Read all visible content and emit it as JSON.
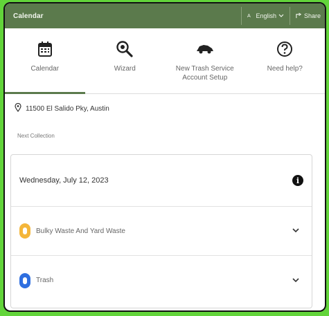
{
  "topbar": {
    "title": "Calendar",
    "language": "English",
    "share": "Share"
  },
  "tabs": [
    {
      "label": "Calendar",
      "icon": "calendar-icon",
      "active": true
    },
    {
      "label": "Wizard",
      "icon": "magnifier-icon",
      "active": false
    },
    {
      "label": "New Trash Service Account Setup",
      "icon": "truck-icon",
      "active": false
    },
    {
      "label": "Need help?",
      "icon": "question-icon",
      "active": false
    }
  ],
  "address": "11500 El Salido Pky, Austin",
  "next_collection": {
    "section_label": "Next Collection",
    "date": "Wednesday, July 12, 2023",
    "items": [
      {
        "label": "Bulky Waste And Yard Waste",
        "color": "#f4b63a"
      },
      {
        "label": "Trash",
        "color": "#2f6fe0"
      }
    ]
  },
  "colors": {
    "brand": "#5b7a4c",
    "background": "#62d43a"
  }
}
